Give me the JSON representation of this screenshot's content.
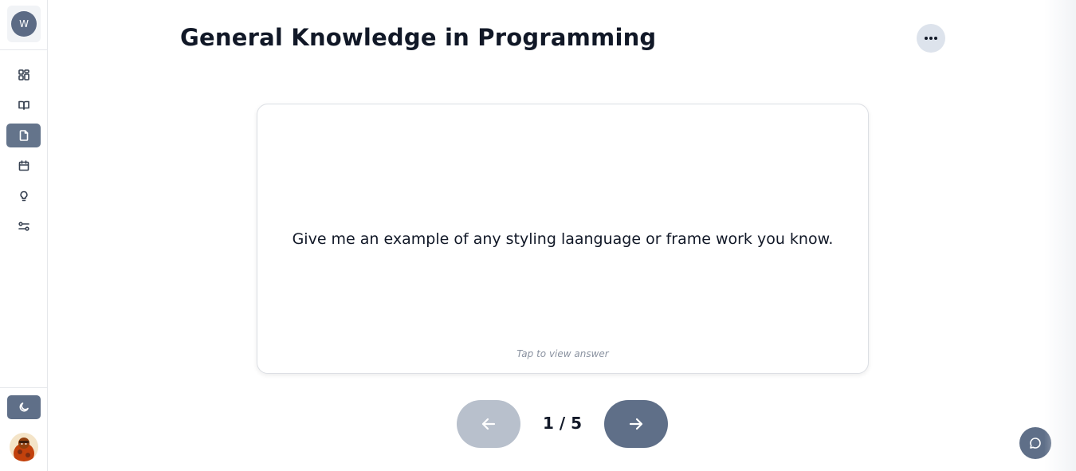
{
  "sidebar": {
    "logo_letter": "W",
    "items": [
      {
        "name": "dashboard",
        "icon": "dashboard-icon",
        "active": false
      },
      {
        "name": "library",
        "icon": "book-icon",
        "active": false
      },
      {
        "name": "flashcards",
        "icon": "document-icon",
        "active": true
      },
      {
        "name": "calendar",
        "icon": "calendar-icon",
        "active": false
      },
      {
        "name": "ideas",
        "icon": "lightbulb-icon",
        "active": false
      },
      {
        "name": "settings",
        "icon": "sliders-icon",
        "active": false
      }
    ],
    "theme_icon": "moon-icon"
  },
  "header": {
    "title": "General Knowledge in Programming",
    "more_icon": "more-horizontal-icon"
  },
  "card": {
    "question": "Give me an example of any styling laanguage or frame work you know.",
    "hint": "Tap to view answer"
  },
  "pager": {
    "current": 1,
    "total": 5,
    "label": "1 / 5",
    "prev_icon": "arrow-left-icon",
    "next_icon": "arrow-right-icon"
  },
  "chat": {
    "icon": "chat-icon"
  },
  "colors": {
    "accent": "#5f6f88",
    "accent_disabled": "#b8c0cc",
    "text": "#111827",
    "hint": "#8b93a1"
  }
}
